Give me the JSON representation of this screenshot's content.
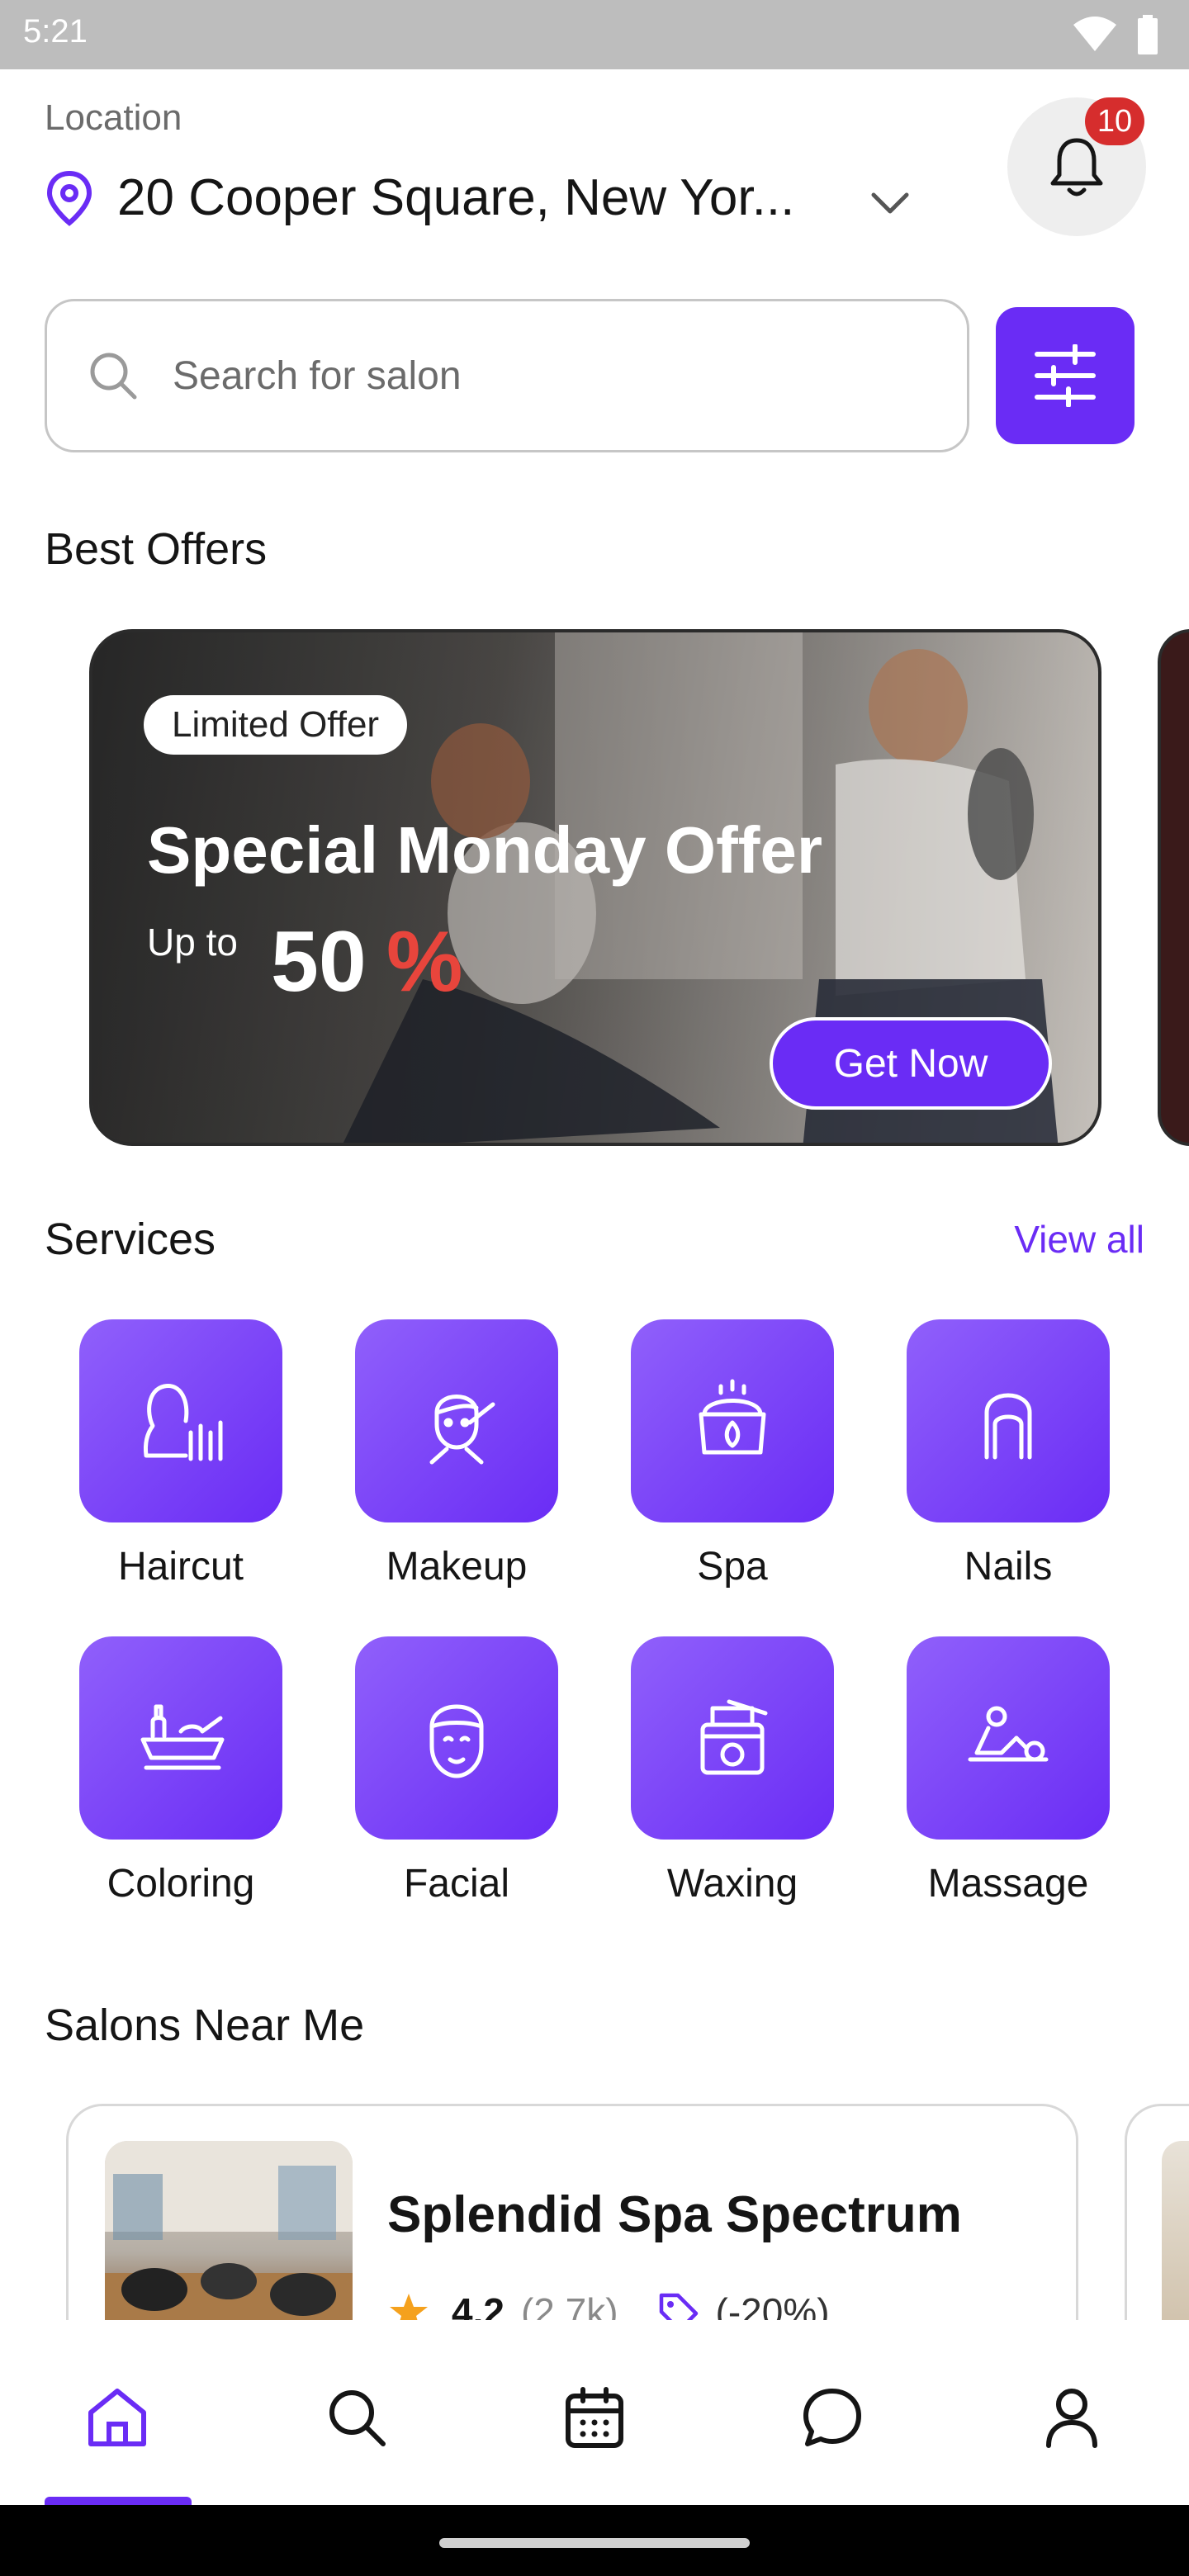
{
  "status_bar": {
    "time": "5:21"
  },
  "header": {
    "location_caption": "Location",
    "location_value": "20 Cooper Square, New Yor...",
    "notification_count": "10"
  },
  "search": {
    "placeholder": "Search for salon"
  },
  "best_offers": {
    "title": "Best Offers",
    "banner": {
      "tag": "Limited Offer",
      "headline": "Special Monday Offer",
      "upto": "Up to",
      "percent_number": "50",
      "percent_sign": "%",
      "cta": "Get Now"
    }
  },
  "services": {
    "title": "Services",
    "view_all": "View all",
    "items": [
      {
        "label": "Haircut",
        "icon": "haircut-icon"
      },
      {
        "label": "Makeup",
        "icon": "makeup-icon"
      },
      {
        "label": "Spa",
        "icon": "spa-icon"
      },
      {
        "label": "Nails",
        "icon": "nails-icon"
      },
      {
        "label": "Coloring",
        "icon": "coloring-icon"
      },
      {
        "label": "Facial",
        "icon": "facial-icon"
      },
      {
        "label": "Waxing",
        "icon": "waxing-icon"
      },
      {
        "label": "Massage",
        "icon": "massage-icon"
      }
    ]
  },
  "salons_near_me": {
    "title": "Salons Near Me",
    "cards": [
      {
        "name": "Splendid Spa Spectrum",
        "rating": "4.2",
        "reviews": "(2.7k)",
        "discount": "(-20%)"
      }
    ]
  },
  "bottom_nav": {
    "items": [
      "home-icon",
      "search-icon",
      "calendar-icon",
      "chat-icon",
      "profile-icon"
    ],
    "active": "home"
  },
  "colors": {
    "accent": "#6a2cf5",
    "badge": "#d62d2d",
    "star": "#f5a11d"
  }
}
